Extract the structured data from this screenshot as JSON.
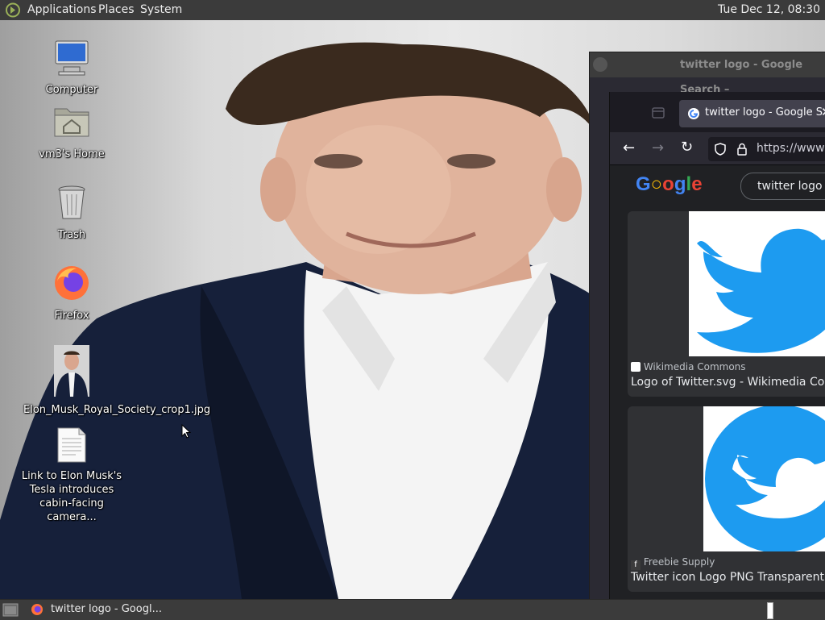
{
  "top_panel": {
    "menus": [
      "Applications",
      "Places",
      "System"
    ],
    "clock": "Tue Dec 12, 08:30"
  },
  "desktop": {
    "icons": [
      {
        "label": "Computer",
        "icon": "computer-icon"
      },
      {
        "label": "vm3's Home",
        "icon": "home-folder-icon"
      },
      {
        "label": "Trash",
        "icon": "trash-icon"
      },
      {
        "label": "Firefox",
        "icon": "firefox-icon"
      },
      {
        "label": "Elon_Musk_Royal_Society_crop1.jpg",
        "icon": "image-file-icon"
      },
      {
        "label": "Link to Elon Musk's Tesla introduces cabin-facing camera...",
        "icon": "document-icon"
      }
    ]
  },
  "browser": {
    "window_title": "twitter logo - Google Search –",
    "tab_title": "twitter logo - Google S",
    "url": "https://www",
    "search_query": "twitter logo",
    "results": [
      {
        "source": "Wikimedia Commons",
        "caption": "Logo of Twitter.svg - Wikimedia Comm"
      },
      {
        "source": "Freebie Supply",
        "caption": "Twitter icon Logo PNG Transparent & S"
      }
    ],
    "colors": {
      "twitter_blue": "#1d9bf0",
      "chrome_dark": "#2b2a33"
    }
  },
  "taskbar": {
    "task_label": "twitter logo - Googl..."
  }
}
